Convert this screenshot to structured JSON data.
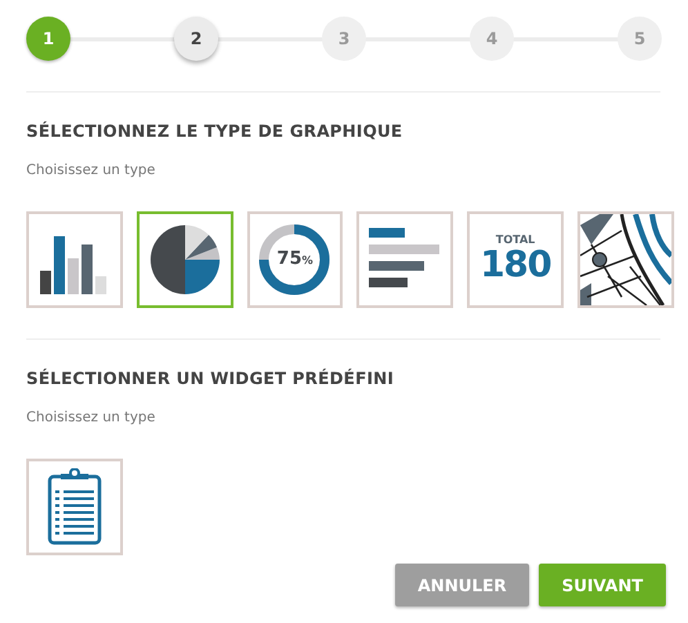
{
  "steps": [
    {
      "label": "1",
      "selected": true,
      "highlighted": false
    },
    {
      "label": "2",
      "selected": false,
      "highlighted": true
    },
    {
      "label": "3",
      "selected": false,
      "highlighted": false
    },
    {
      "label": "4",
      "selected": false,
      "highlighted": false
    },
    {
      "label": "5",
      "selected": false,
      "highlighted": false
    }
  ],
  "sections": [
    {
      "title": "SÉLECTIONNEZ LE TYPE DE GRAPHIQUE",
      "subtitle": "Choisissez un type",
      "tiles": [
        {
          "kind": "bar",
          "selected": false
        },
        {
          "kind": "pie",
          "selected": true
        },
        {
          "kind": "donut",
          "selected": false,
          "text": "75",
          "unit": "%"
        },
        {
          "kind": "hbar",
          "selected": false
        },
        {
          "kind": "total",
          "selected": false,
          "caption": "TOTAL",
          "text": "180"
        },
        {
          "kind": "map",
          "selected": false
        }
      ]
    },
    {
      "title": "SÉLECTIONNER UN WIDGET PRÉDÉFINI",
      "subtitle": "Choisissez un type",
      "tiles": [
        {
          "kind": "clipboard",
          "selected": false
        }
      ]
    }
  ],
  "buttons": [
    {
      "label": "ANNULER",
      "kind": "secondary"
    },
    {
      "label": "SUIVANT",
      "kind": "primary"
    }
  ]
}
